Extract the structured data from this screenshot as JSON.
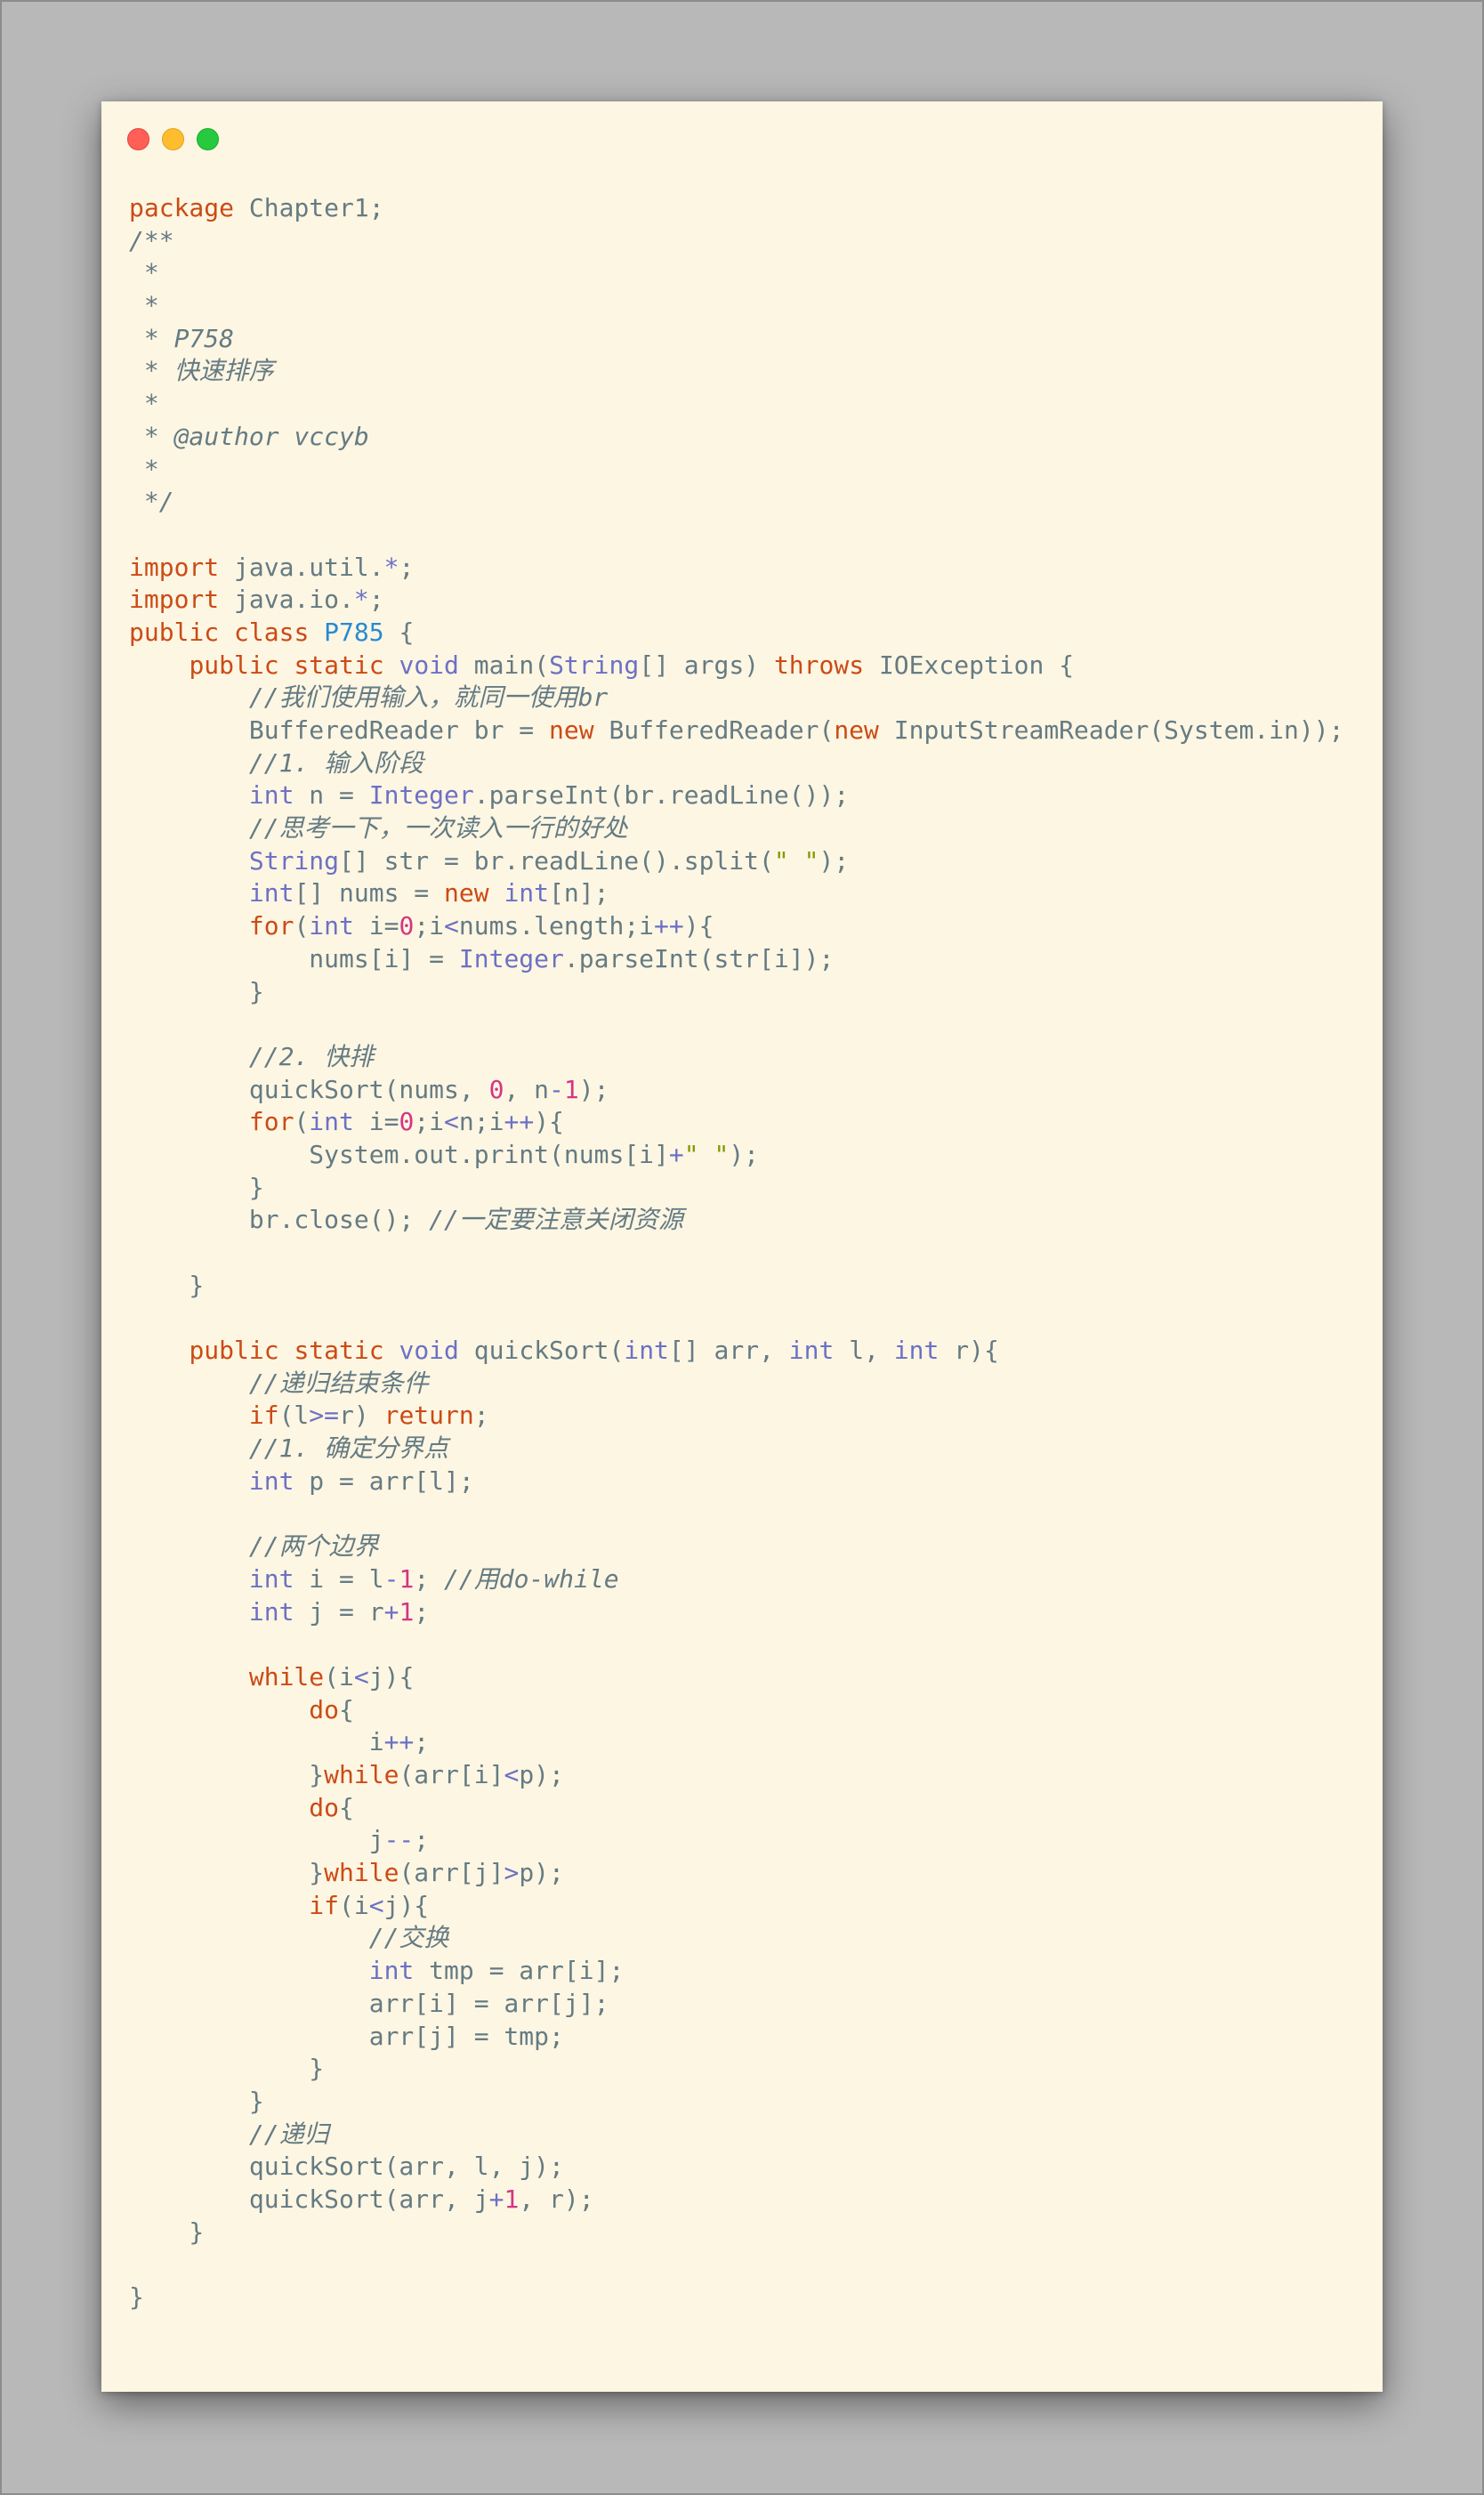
{
  "window": {
    "controls": [
      {
        "name": "close-button",
        "color": "#ff5f56"
      },
      {
        "name": "minimize-button",
        "color": "#ffbd2e"
      },
      {
        "name": "maximize-button",
        "color": "#27c93f"
      }
    ]
  },
  "theme": {
    "background": "#fdf6e3",
    "keyword": "#cb4b16",
    "type": "#6c71c4",
    "class": "#268bd2",
    "comment": "#657b83",
    "number": "#d33682",
    "string": "#859900",
    "plain": "#657b83"
  },
  "code": {
    "language": "java",
    "lines": [
      [
        [
          "keyword",
          "package"
        ],
        [
          "plain",
          " Chapter1;"
        ]
      ],
      [
        [
          "comment",
          "/**"
        ]
      ],
      [
        [
          "comment",
          " *"
        ]
      ],
      [
        [
          "comment",
          " *"
        ]
      ],
      [
        [
          "comment",
          " * P758"
        ]
      ],
      [
        [
          "comment",
          " * 快速排序"
        ]
      ],
      [
        [
          "comment",
          " *"
        ]
      ],
      [
        [
          "comment",
          " * @author vccyb"
        ]
      ],
      [
        [
          "comment",
          " *"
        ]
      ],
      [
        [
          "comment",
          " */"
        ]
      ],
      [],
      [
        [
          "keyword",
          "import"
        ],
        [
          "plain",
          " java.util."
        ],
        [
          "op",
          "*"
        ],
        [
          "plain",
          ";"
        ]
      ],
      [
        [
          "keyword",
          "import"
        ],
        [
          "plain",
          " java.io."
        ],
        [
          "op",
          "*"
        ],
        [
          "plain",
          ";"
        ]
      ],
      [
        [
          "keyword",
          "public"
        ],
        [
          "plain",
          " "
        ],
        [
          "keyword",
          "class"
        ],
        [
          "plain",
          " "
        ],
        [
          "class",
          "P785"
        ],
        [
          "plain",
          " {"
        ]
      ],
      [
        [
          "plain",
          "    "
        ],
        [
          "keyword",
          "public"
        ],
        [
          "plain",
          " "
        ],
        [
          "keyword",
          "static"
        ],
        [
          "plain",
          " "
        ],
        [
          "type",
          "void"
        ],
        [
          "plain",
          " main("
        ],
        [
          "type",
          "String"
        ],
        [
          "plain",
          "[] args) "
        ],
        [
          "keyword",
          "throws"
        ],
        [
          "plain",
          " IOException {"
        ]
      ],
      [
        [
          "plain",
          "        "
        ],
        [
          "comment",
          "//我们使用输入，就同一使用br"
        ]
      ],
      [
        [
          "plain",
          "        BufferedReader br = "
        ],
        [
          "keyword",
          "new"
        ],
        [
          "plain",
          " BufferedReader("
        ],
        [
          "keyword",
          "new"
        ],
        [
          "plain",
          " InputStreamReader(System.in));"
        ]
      ],
      [
        [
          "plain",
          "        "
        ],
        [
          "comment",
          "//1. 输入阶段"
        ]
      ],
      [
        [
          "plain",
          "        "
        ],
        [
          "type",
          "int"
        ],
        [
          "plain",
          " n = "
        ],
        [
          "type",
          "Integer"
        ],
        [
          "plain",
          ".parseInt(br.readLine());"
        ]
      ],
      [
        [
          "plain",
          "        "
        ],
        [
          "comment",
          "//思考一下，一次读入一行的好处"
        ]
      ],
      [
        [
          "plain",
          "        "
        ],
        [
          "type",
          "String"
        ],
        [
          "plain",
          "[] str = br.readLine().split("
        ],
        [
          "string",
          "\" \""
        ],
        [
          "plain",
          ");"
        ]
      ],
      [
        [
          "plain",
          "        "
        ],
        [
          "type",
          "int"
        ],
        [
          "plain",
          "[] nums = "
        ],
        [
          "keyword",
          "new"
        ],
        [
          "plain",
          " "
        ],
        [
          "type",
          "int"
        ],
        [
          "plain",
          "[n];"
        ]
      ],
      [
        [
          "plain",
          "        "
        ],
        [
          "keyword",
          "for"
        ],
        [
          "plain",
          "("
        ],
        [
          "type",
          "int"
        ],
        [
          "plain",
          " i="
        ],
        [
          "number",
          "0"
        ],
        [
          "plain",
          ";i"
        ],
        [
          "op",
          "<"
        ],
        [
          "plain",
          "nums.length;i"
        ],
        [
          "op",
          "++"
        ],
        [
          "plain",
          "){"
        ]
      ],
      [
        [
          "plain",
          "            nums[i] = "
        ],
        [
          "type",
          "Integer"
        ],
        [
          "plain",
          ".parseInt(str[i]);"
        ]
      ],
      [
        [
          "plain",
          "        }"
        ]
      ],
      [],
      [
        [
          "plain",
          "        "
        ],
        [
          "comment",
          "//2. 快排"
        ]
      ],
      [
        [
          "plain",
          "        quickSort(nums, "
        ],
        [
          "number",
          "0"
        ],
        [
          "plain",
          ", n"
        ],
        [
          "op",
          "-"
        ],
        [
          "number",
          "1"
        ],
        [
          "plain",
          ");"
        ]
      ],
      [
        [
          "plain",
          "        "
        ],
        [
          "keyword",
          "for"
        ],
        [
          "plain",
          "("
        ],
        [
          "type",
          "int"
        ],
        [
          "plain",
          " i="
        ],
        [
          "number",
          "0"
        ],
        [
          "plain",
          ";i"
        ],
        [
          "op",
          "<"
        ],
        [
          "plain",
          "n;i"
        ],
        [
          "op",
          "++"
        ],
        [
          "plain",
          "){"
        ]
      ],
      [
        [
          "plain",
          "            System.out.print(nums[i]"
        ],
        [
          "op",
          "+"
        ],
        [
          "string",
          "\" \""
        ],
        [
          "plain",
          ");"
        ]
      ],
      [
        [
          "plain",
          "        }"
        ]
      ],
      [
        [
          "plain",
          "        br.close(); "
        ],
        [
          "comment",
          "//一定要注意关闭资源"
        ]
      ],
      [],
      [
        [
          "plain",
          "    }"
        ]
      ],
      [],
      [
        [
          "plain",
          "    "
        ],
        [
          "keyword",
          "public"
        ],
        [
          "plain",
          " "
        ],
        [
          "keyword",
          "static"
        ],
        [
          "plain",
          " "
        ],
        [
          "type",
          "void"
        ],
        [
          "plain",
          " quickSort("
        ],
        [
          "type",
          "int"
        ],
        [
          "plain",
          "[] arr, "
        ],
        [
          "type",
          "int"
        ],
        [
          "plain",
          " l, "
        ],
        [
          "type",
          "int"
        ],
        [
          "plain",
          " r){"
        ]
      ],
      [
        [
          "plain",
          "        "
        ],
        [
          "comment",
          "//递归结束条件"
        ]
      ],
      [
        [
          "plain",
          "        "
        ],
        [
          "keyword",
          "if"
        ],
        [
          "plain",
          "(l"
        ],
        [
          "op",
          ">="
        ],
        [
          "plain",
          "r) "
        ],
        [
          "keyword",
          "return"
        ],
        [
          "plain",
          ";"
        ]
      ],
      [
        [
          "plain",
          "        "
        ],
        [
          "comment",
          "//1. 确定分界点"
        ]
      ],
      [
        [
          "plain",
          "        "
        ],
        [
          "type",
          "int"
        ],
        [
          "plain",
          " p = arr[l];"
        ]
      ],
      [],
      [
        [
          "plain",
          "        "
        ],
        [
          "comment",
          "//两个边界"
        ]
      ],
      [
        [
          "plain",
          "        "
        ],
        [
          "type",
          "int"
        ],
        [
          "plain",
          " i = l"
        ],
        [
          "op",
          "-"
        ],
        [
          "number",
          "1"
        ],
        [
          "plain",
          "; "
        ],
        [
          "comment",
          "//用do-while"
        ]
      ],
      [
        [
          "plain",
          "        "
        ],
        [
          "type",
          "int"
        ],
        [
          "plain",
          " j = r"
        ],
        [
          "op",
          "+"
        ],
        [
          "number",
          "1"
        ],
        [
          "plain",
          ";"
        ]
      ],
      [],
      [
        [
          "plain",
          "        "
        ],
        [
          "keyword",
          "while"
        ],
        [
          "plain",
          "(i"
        ],
        [
          "op",
          "<"
        ],
        [
          "plain",
          "j){"
        ]
      ],
      [
        [
          "plain",
          "            "
        ],
        [
          "keyword",
          "do"
        ],
        [
          "plain",
          "{"
        ]
      ],
      [
        [
          "plain",
          "                i"
        ],
        [
          "op",
          "++"
        ],
        [
          "plain",
          ";"
        ]
      ],
      [
        [
          "plain",
          "            }"
        ],
        [
          "keyword",
          "while"
        ],
        [
          "plain",
          "(arr[i]"
        ],
        [
          "op",
          "<"
        ],
        [
          "plain",
          "p);"
        ]
      ],
      [
        [
          "plain",
          "            "
        ],
        [
          "keyword",
          "do"
        ],
        [
          "plain",
          "{"
        ]
      ],
      [
        [
          "plain",
          "                j"
        ],
        [
          "op",
          "--"
        ],
        [
          "plain",
          ";"
        ]
      ],
      [
        [
          "plain",
          "            }"
        ],
        [
          "keyword",
          "while"
        ],
        [
          "plain",
          "(arr[j]"
        ],
        [
          "op",
          ">"
        ],
        [
          "plain",
          "p);"
        ]
      ],
      [
        [
          "plain",
          "            "
        ],
        [
          "keyword",
          "if"
        ],
        [
          "plain",
          "(i"
        ],
        [
          "op",
          "<"
        ],
        [
          "plain",
          "j){"
        ]
      ],
      [
        [
          "plain",
          "                "
        ],
        [
          "comment",
          "//交换"
        ]
      ],
      [
        [
          "plain",
          "                "
        ],
        [
          "type",
          "int"
        ],
        [
          "plain",
          " tmp = arr[i];"
        ]
      ],
      [
        [
          "plain",
          "                arr[i] = arr[j];"
        ]
      ],
      [
        [
          "plain",
          "                arr[j] = tmp;"
        ]
      ],
      [
        [
          "plain",
          "            }"
        ]
      ],
      [
        [
          "plain",
          "        }"
        ]
      ],
      [
        [
          "plain",
          "        "
        ],
        [
          "comment",
          "//递归"
        ]
      ],
      [
        [
          "plain",
          "        quickSort(arr, l, j);"
        ]
      ],
      [
        [
          "plain",
          "        quickSort(arr, j"
        ],
        [
          "op",
          "+"
        ],
        [
          "number",
          "1"
        ],
        [
          "plain",
          ", r);"
        ]
      ],
      [
        [
          "plain",
          "    }"
        ]
      ],
      [],
      [
        [
          "plain",
          "}"
        ]
      ]
    ]
  }
}
